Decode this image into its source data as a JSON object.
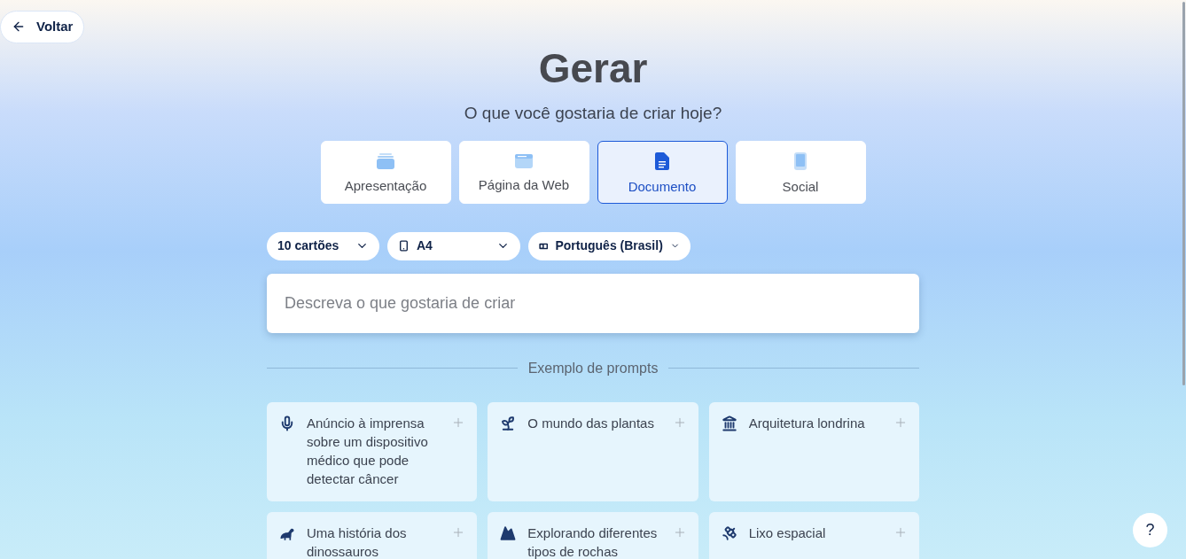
{
  "back_button": {
    "label": "Voltar"
  },
  "title": "Gerar",
  "subtitle": "O que você gostaria de criar hoje?",
  "types": [
    {
      "label": "Apresentação",
      "selected": false
    },
    {
      "label": "Página da Web",
      "selected": false
    },
    {
      "label": "Documento",
      "selected": true
    },
    {
      "label": "Social",
      "selected": false
    }
  ],
  "options": [
    {
      "label": "10 cartões"
    },
    {
      "label": "A4"
    },
    {
      "label": "Português (Brasil)"
    }
  ],
  "prompt_field": {
    "placeholder": "Descreva o que gostaria de criar"
  },
  "examples_heading": "Exemplo de prompts",
  "examples": [
    {
      "text": "Anúncio à imprensa sobre um dispositivo médico que pode detectar câncer"
    },
    {
      "text": "O mundo das plantas"
    },
    {
      "text": "Arquitetura londrina"
    },
    {
      "text": "Uma história dos dinossauros"
    },
    {
      "text": "Explorando diferentes tipos de rochas"
    },
    {
      "text": "Lixo espacial"
    }
  ],
  "help_button": {
    "label": "?"
  }
}
